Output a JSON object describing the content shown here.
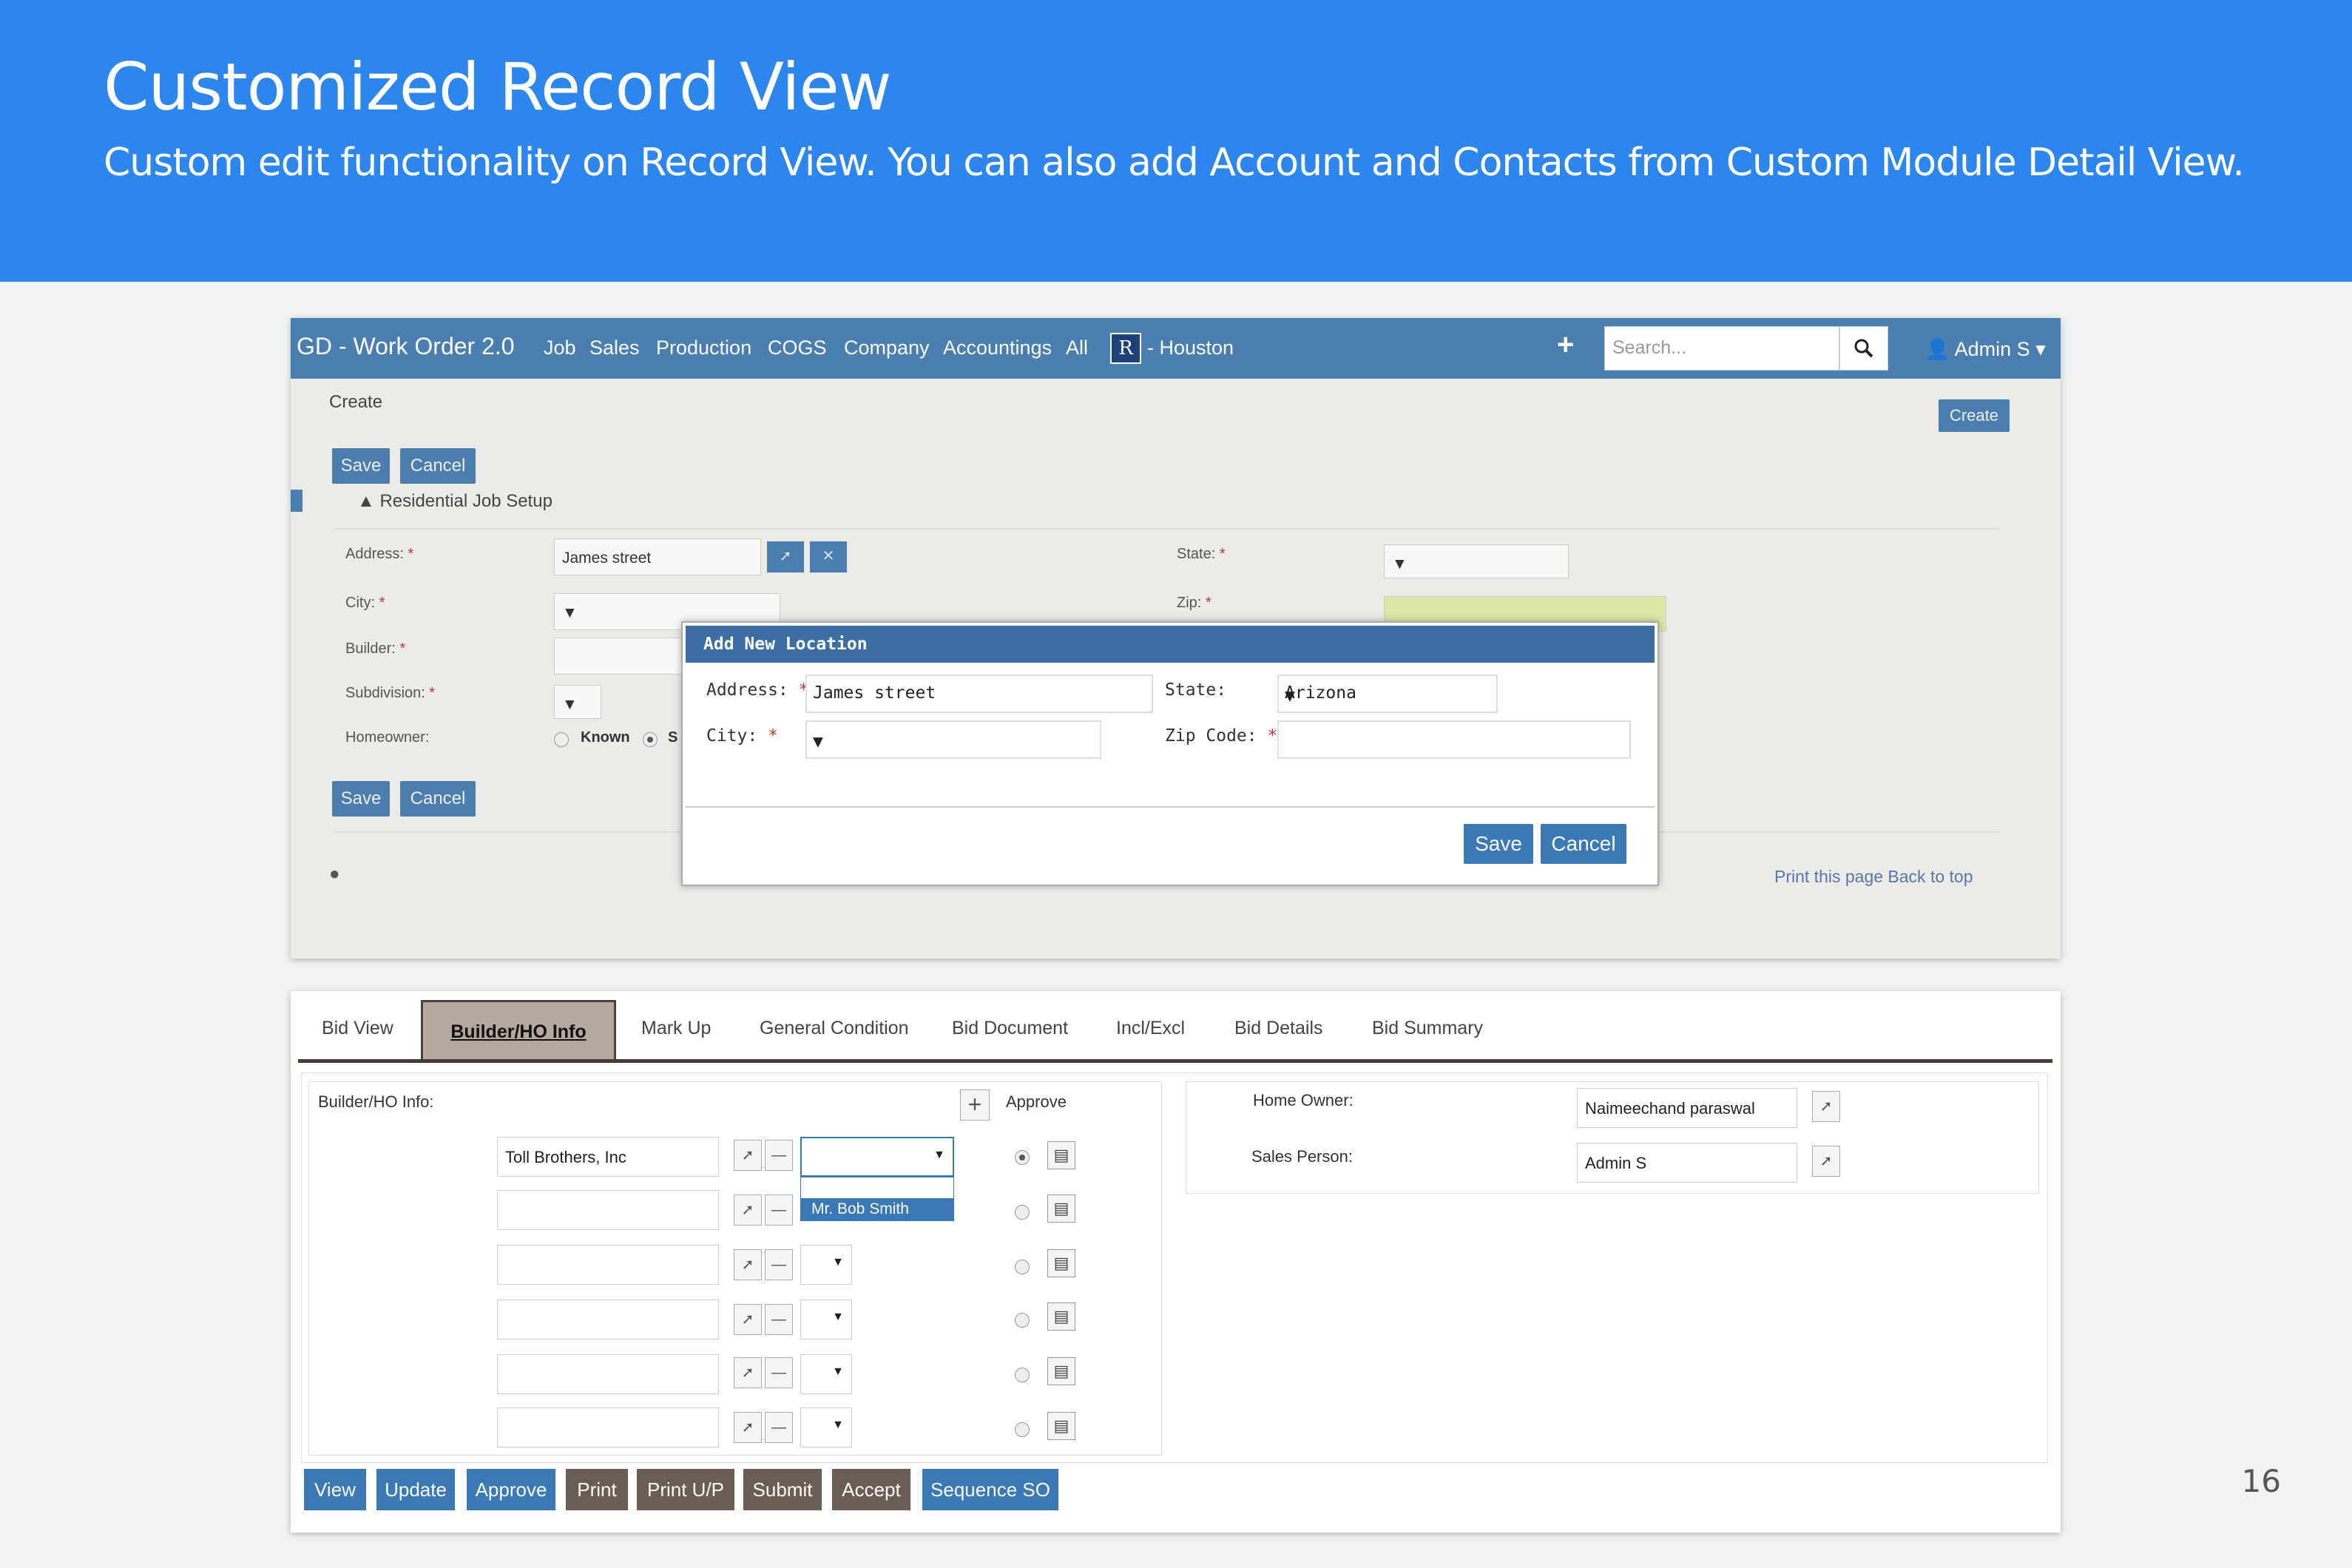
{
  "banner": {
    "title": "Customized Record View",
    "subtitle": "Custom edit functionality on Record View. You can also add Account and Contacts from Custom Module Detail View."
  },
  "page_number": "16",
  "crm": {
    "brand": "GD - Work Order 2.0",
    "nav": [
      "Job",
      "Sales",
      "Production",
      "COGS",
      "Company",
      "Accountings",
      "All"
    ],
    "location": "- Houston",
    "rlogo": "R",
    "search_placeholder": "Search...",
    "user": "Admin S",
    "breadcrumb": "Create",
    "create_btn": "Create",
    "save": "Save",
    "cancel": "Cancel",
    "section": "Residential Job Setup",
    "form": {
      "address_label": "Address:",
      "address_value": "James street",
      "city_label": "City:",
      "builder_label": "Builder:",
      "subdivision_label": "Subdivision:",
      "homeowner_label": "Homeowner:",
      "known": "Known",
      "s": "S",
      "state_label": "State:",
      "zip_label": "Zip:"
    },
    "footer_links": "Print this page Back to top",
    "modal": {
      "title": "Add New Location",
      "address_label": "Address:",
      "address_value": "James street",
      "state_label": "State:",
      "state_value": "Arizona",
      "city_label": "City:",
      "zip_label": "Zip Code:",
      "save": "Save",
      "cancel": "Cancel"
    }
  },
  "bid": {
    "tabs": [
      "Bid View",
      "Builder/HO Info",
      "Mark Up",
      "General Condition",
      "Bid Document",
      "Incl/Excl",
      "Bid Details",
      "Bid Summary"
    ],
    "panel_label": "Builder/HO Info:",
    "approve": "Approve",
    "rows": [
      "Toll Brothers, Inc",
      "",
      "",
      "",
      "",
      ""
    ],
    "dropdown_option": "Mr. Bob Smith",
    "home_owner_label": "Home Owner:",
    "home_owner_value": "Naimeechand paraswal",
    "sales_person_label": "Sales Person:",
    "sales_person_value": "Admin S",
    "buttons": [
      "View",
      "Update",
      "Approve",
      "Print",
      "Print U/P",
      "Submit",
      "Accept",
      "Sequence SO"
    ]
  }
}
